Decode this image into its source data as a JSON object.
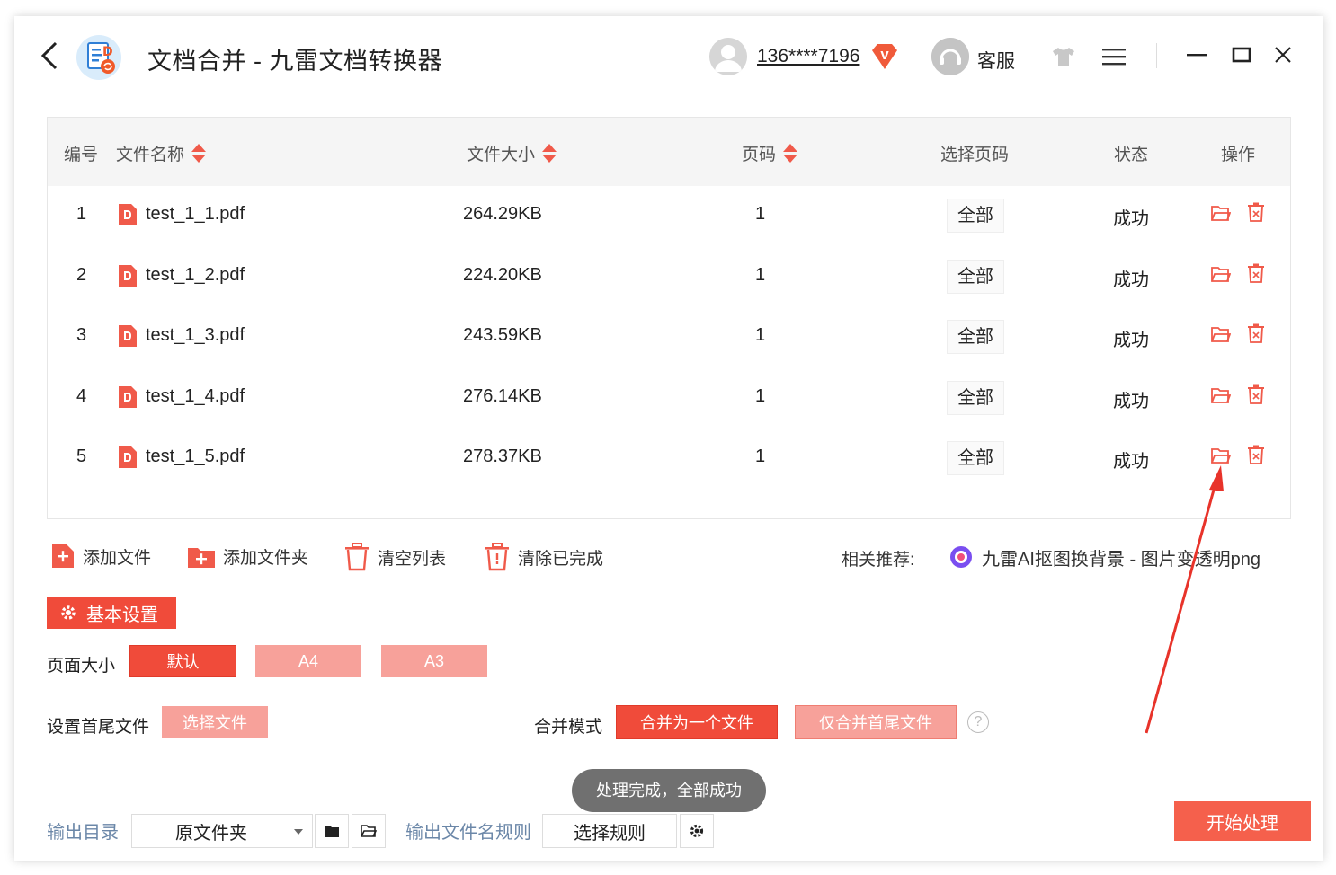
{
  "app": {
    "title": "文档合并 - 九雷文档转换器",
    "user_phone": "136****7196",
    "vip_badge": "V",
    "service_label": "客服"
  },
  "table": {
    "headers": {
      "index": "编号",
      "name": "文件名称",
      "size": "文件大小",
      "pages": "页码",
      "page_range": "选择页码",
      "status": "状态",
      "actions": "操作"
    },
    "rows": [
      {
        "index": "1",
        "name": "test_1_1.pdf",
        "size": "264.29KB",
        "pages": "1",
        "range": "全部",
        "status": "成功"
      },
      {
        "index": "2",
        "name": "test_1_2.pdf",
        "size": "224.20KB",
        "pages": "1",
        "range": "全部",
        "status": "成功"
      },
      {
        "index": "3",
        "name": "test_1_3.pdf",
        "size": "243.59KB",
        "pages": "1",
        "range": "全部",
        "status": "成功"
      },
      {
        "index": "4",
        "name": "test_1_4.pdf",
        "size": "276.14KB",
        "pages": "1",
        "range": "全部",
        "status": "成功"
      },
      {
        "index": "5",
        "name": "test_1_5.pdf",
        "size": "278.37KB",
        "pages": "1",
        "range": "全部",
        "status": "成功"
      }
    ]
  },
  "toolbar": {
    "add_file": "添加文件",
    "add_folder": "添加文件夹",
    "clear_list": "清空列表",
    "clear_done": "清除已完成",
    "recommend_label": "相关推荐:",
    "recommend_link": "九雷AI抠图换背景 - 图片变透明png"
  },
  "settings": {
    "section_title": "基本设置",
    "page_size_label": "页面大小",
    "page_size_options": [
      "默认",
      "A4",
      "A3"
    ],
    "head_tail_label": "设置首尾文件",
    "select_file": "选择文件",
    "merge_mode_label": "合并模式",
    "merge_modes": [
      "合并为一个文件",
      "仅合并首尾文件"
    ],
    "help": "?"
  },
  "toast": "处理完成，全部成功",
  "bottom": {
    "output_dir_label": "输出目录",
    "output_dir_value": "原文件夹",
    "name_rule_label": "输出文件名规则",
    "choose_rule": "选择规则",
    "start": "开始处理"
  },
  "colors": {
    "accent": "#f04b3a",
    "accent_light": "#f7a19a",
    "label_blue": "#6b87a8",
    "annotation_arrow": "#e8332a"
  }
}
